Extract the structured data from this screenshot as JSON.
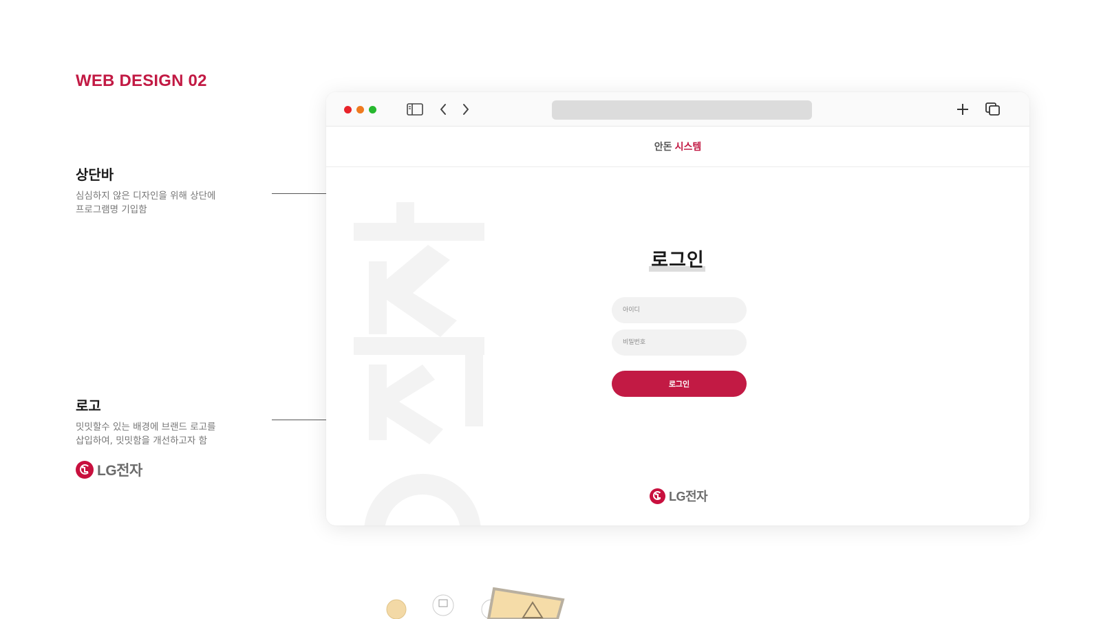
{
  "page": {
    "heading": "WEB DESIGN 02"
  },
  "annotations": {
    "topbar": {
      "title": "상단바",
      "description": "심심하지 않은 디자인을 위해 상단에\n프로그램명 기입함"
    },
    "logo": {
      "title": "로고",
      "description": "밋밋할수 있는 배경에 브랜드 로고를\n삽입하여, 밋밋함을 개선하고자 함"
    }
  },
  "brand": {
    "logo_text": "LG전자",
    "logo_mark_icon": "lg-face-icon",
    "color": "#c21a44",
    "watermark_text": "안돈"
  },
  "browser": {
    "traffic_colors": [
      "#e8232a",
      "#ef7a1f",
      "#27b82f"
    ],
    "icons": [
      "sidebar-icon",
      "back-icon",
      "forward-icon",
      "new-tab-icon",
      "tabs-overview-icon"
    ]
  },
  "app": {
    "header_title_part1": "안돈",
    "header_title_part2": "시스템",
    "login": {
      "heading": "로그인",
      "id_placeholder": "아이디",
      "password_placeholder": "비밀번호",
      "button_label": "로그인"
    }
  }
}
